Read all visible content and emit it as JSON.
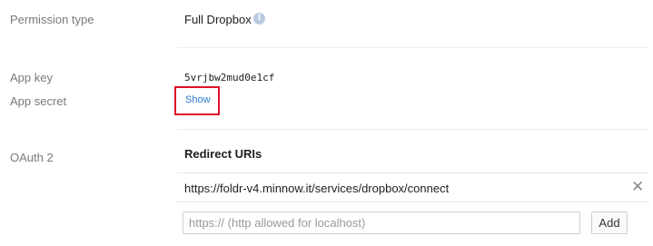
{
  "permission": {
    "label": "Permission type",
    "value": "Full Dropbox",
    "info_icon": "i"
  },
  "keys": {
    "app_key_label": "App key",
    "app_key_value": "5vrjbw2mud0e1cf",
    "app_secret_label": "App secret",
    "show_label": "Show"
  },
  "oauth": {
    "label": "OAuth 2",
    "redirect_heading": "Redirect URIs",
    "uris": [
      "https://foldr-v4.minnow.it/services/dropbox/connect"
    ],
    "remove_glyph": "✕",
    "input_placeholder": "https:// (http allowed for localhost)",
    "input_value": "",
    "add_label": "Add"
  },
  "colors": {
    "highlight_box": "#e0102a",
    "link": "#2a7bd2",
    "info_icon_bg": "#b8cbe0"
  }
}
